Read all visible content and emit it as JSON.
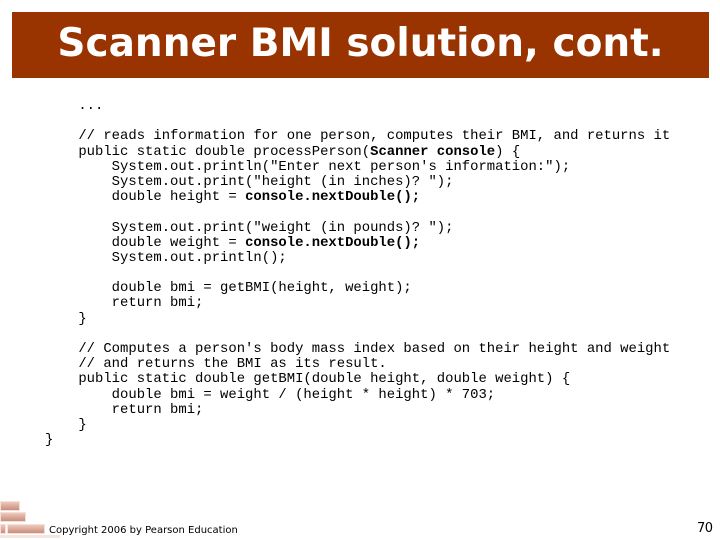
{
  "slide": {
    "title": "Scanner BMI solution, cont.",
    "page_number": "70",
    "footer": "Copyright 2006 by Pearson Education",
    "colors": {
      "title_bar": "#993300",
      "title_text": "#ffffff",
      "brick_accent": "#d9a393"
    }
  },
  "code": {
    "lines": [
      {
        "segments": [
          {
            "text": "    ...",
            "bold": false
          }
        ]
      },
      {
        "segments": [
          {
            "text": "",
            "bold": false
          }
        ]
      },
      {
        "segments": [
          {
            "text": "    // reads information for one person, computes their BMI, and returns it",
            "bold": false
          }
        ]
      },
      {
        "segments": [
          {
            "text": "    public static double processPerson(",
            "bold": false
          },
          {
            "text": "Scanner console",
            "bold": true
          },
          {
            "text": ") {",
            "bold": false
          }
        ]
      },
      {
        "segments": [
          {
            "text": "        System.out.println(\"Enter next person's information:\");",
            "bold": false
          }
        ]
      },
      {
        "segments": [
          {
            "text": "        System.out.print(\"height (in inches)? \");",
            "bold": false
          }
        ]
      },
      {
        "segments": [
          {
            "text": "        double height = ",
            "bold": false
          },
          {
            "text": "console.nextDouble();",
            "bold": true
          }
        ]
      },
      {
        "segments": [
          {
            "text": "",
            "bold": false
          }
        ]
      },
      {
        "segments": [
          {
            "text": "        System.out.print(\"weight (in pounds)? \");",
            "bold": false
          }
        ]
      },
      {
        "segments": [
          {
            "text": "        double weight = ",
            "bold": false
          },
          {
            "text": "console.nextDouble();",
            "bold": true
          }
        ]
      },
      {
        "segments": [
          {
            "text": "        System.out.println();",
            "bold": false
          }
        ]
      },
      {
        "segments": [
          {
            "text": "",
            "bold": false
          }
        ]
      },
      {
        "segments": [
          {
            "text": "        double bmi = getBMI(height, weight);",
            "bold": false
          }
        ]
      },
      {
        "segments": [
          {
            "text": "        return bmi;",
            "bold": false
          }
        ]
      },
      {
        "segments": [
          {
            "text": "    }",
            "bold": false
          }
        ]
      },
      {
        "segments": [
          {
            "text": "",
            "bold": false
          }
        ]
      },
      {
        "segments": [
          {
            "text": "    // Computes a person's body mass index based on their height and weight",
            "bold": false
          }
        ]
      },
      {
        "segments": [
          {
            "text": "    // and returns the BMI as its result.",
            "bold": false
          }
        ]
      },
      {
        "segments": [
          {
            "text": "    public static double getBMI(double height, double weight) {",
            "bold": false
          }
        ]
      },
      {
        "segments": [
          {
            "text": "        double bmi = weight / (height * height) * 703;",
            "bold": false
          }
        ]
      },
      {
        "segments": [
          {
            "text": "        return bmi;",
            "bold": false
          }
        ]
      },
      {
        "segments": [
          {
            "text": "    }",
            "bold": false
          }
        ]
      },
      {
        "segments": [
          {
            "text": "}",
            "bold": false
          }
        ]
      }
    ]
  }
}
